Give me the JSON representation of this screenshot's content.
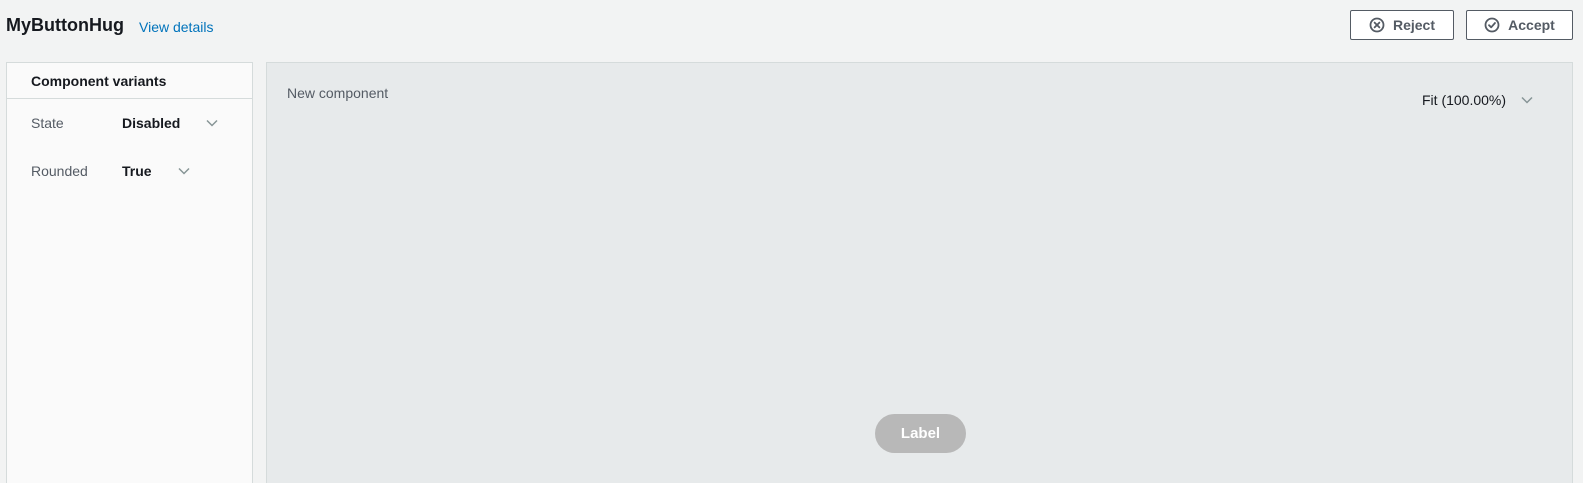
{
  "header": {
    "title": "MyButtonHug",
    "view_details_link": "View details",
    "reject_label": "Reject",
    "accept_label": "Accept"
  },
  "variants_panel": {
    "title": "Component variants",
    "rows": [
      {
        "label": "State",
        "value": "Disabled"
      },
      {
        "label": "Rounded",
        "value": "True"
      }
    ]
  },
  "canvas": {
    "title": "New component",
    "zoom": "Fit (100.00%)",
    "preview_button_label": "Label",
    "preview_button_state": "disabled"
  },
  "icons": {
    "reject": "close-circle-icon",
    "accept": "check-circle-icon",
    "dropdown": "chevron-down-icon"
  },
  "colors": {
    "link": "#0073bb",
    "border": "#545b64",
    "preview_disabled_bg": "#b8b8b8"
  }
}
